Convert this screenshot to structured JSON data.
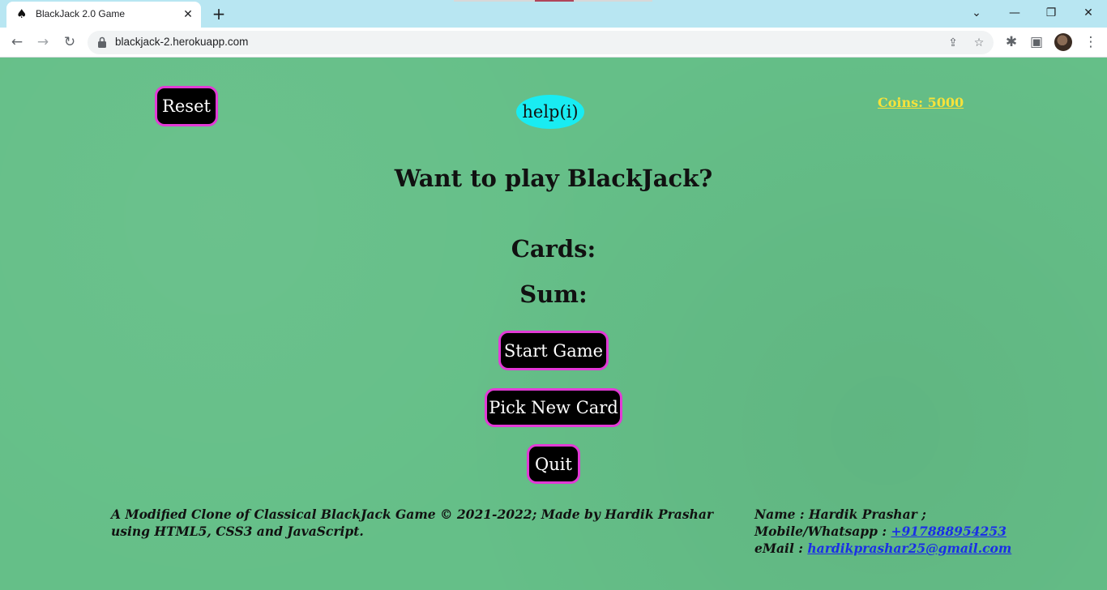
{
  "browser": {
    "tab_title": "BlackJack 2.0 Game",
    "tab_icon": "spade-icon",
    "tab_close": "✕",
    "new_tab": "+",
    "url": "blackjack-2.herokuapp.com",
    "window_controls": {
      "tab_search": "⌄",
      "minimize": "—",
      "restore": "❐",
      "close": "✕"
    },
    "nav": {
      "back": "←",
      "forward": "→",
      "reload": "↻"
    },
    "omnibox_icons": {
      "share": "⇪",
      "bookmark": "☆"
    },
    "toolbar_icons": {
      "extensions": "✱",
      "side_panel": "▣",
      "menu": "⋮"
    }
  },
  "page": {
    "reset_label": "Reset",
    "help_label": "help(i)",
    "coins_label": "Coins: 5000",
    "message": "Want to play BlackJack?",
    "cards_label": "Cards:",
    "sum_label": "Sum:",
    "start_label": "Start Game",
    "pick_label": "Pick New Card",
    "quit_label": "Quit"
  },
  "footer": {
    "credit_text": "A Modified Clone of Classical BlackJack Game © 2021-2022; Made by Hardik Prashar using HTML5, CSS3 and JavaScript.",
    "name_line": "Name : Hardik Prashar ;",
    "mobile_prefix": "Mobile/Whatsapp :",
    "mobile_link": "+917888954253",
    "email_prefix": "eMail :",
    "email_link": "hardikprashar25@gmail.com"
  },
  "colors": {
    "felt": "#65bf88",
    "button_bg": "#000000",
    "button_border": "#e23ad6",
    "help_bg": "#19ecf2",
    "coins": "#f7e23a",
    "link": "#1a2fe6"
  }
}
